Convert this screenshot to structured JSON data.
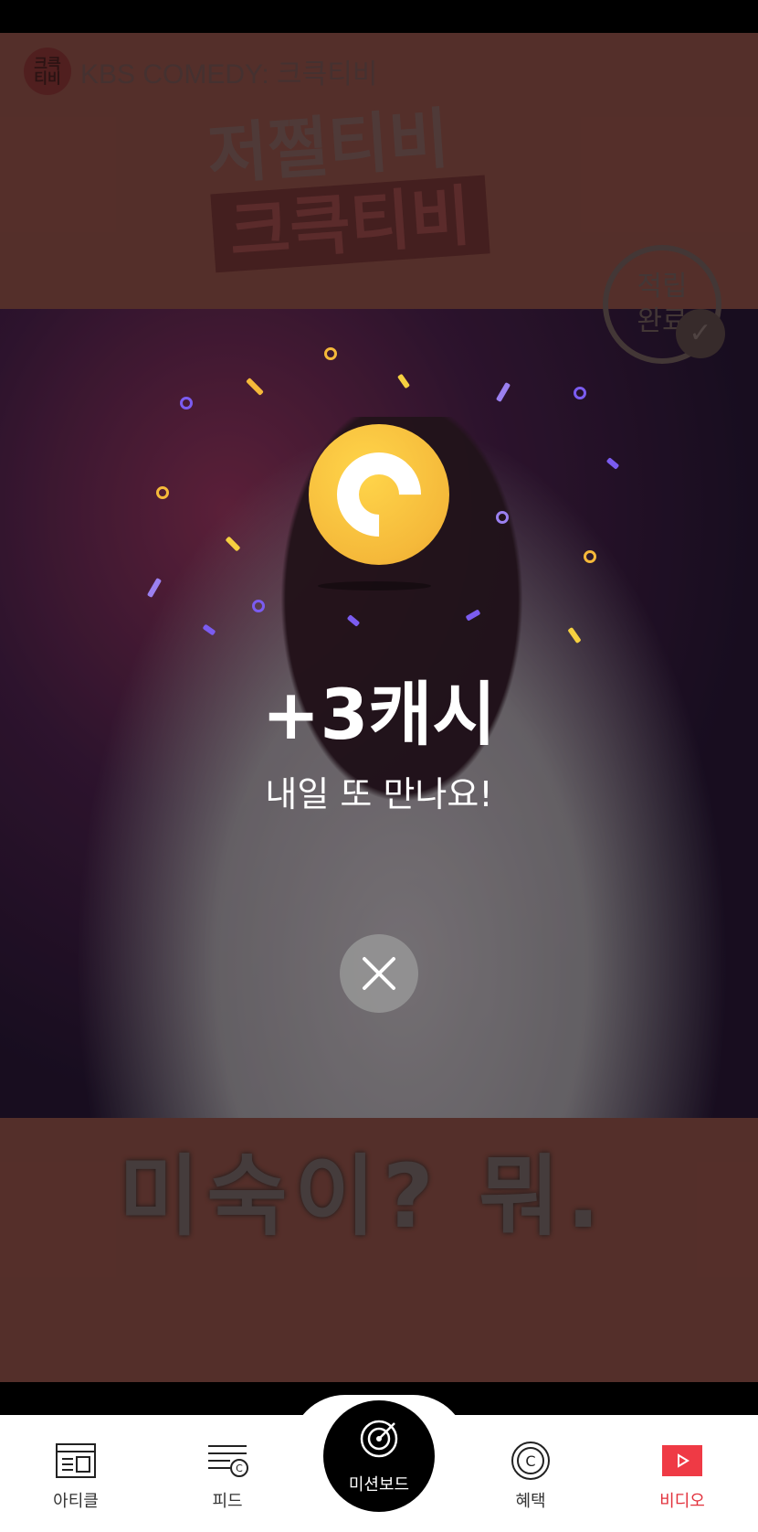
{
  "video": {
    "channel_logo_text": "크큭\n티비",
    "channel_name": "KBS COMEDY: 크큭티비",
    "title_line1": "저쩔티비",
    "title_line2": "크큭티비",
    "stamp_text": "적립\n완료",
    "caption": "미숙이? 뭐."
  },
  "reward": {
    "amount": "+3캐시",
    "message": "내일 또 만나요!",
    "coin_icon": "cash-coin-icon"
  },
  "nav": {
    "items": [
      {
        "label": "아티클",
        "icon": "article-icon"
      },
      {
        "label": "피드",
        "icon": "feed-icon"
      },
      {
        "label": "미션보드",
        "icon": "mission-target-icon"
      },
      {
        "label": "혜택",
        "icon": "benefit-coin-icon"
      },
      {
        "label": "비디오",
        "icon": "video-play-icon"
      }
    ]
  },
  "colors": {
    "accent": "#e2313c",
    "coin": "#f5b93a"
  }
}
